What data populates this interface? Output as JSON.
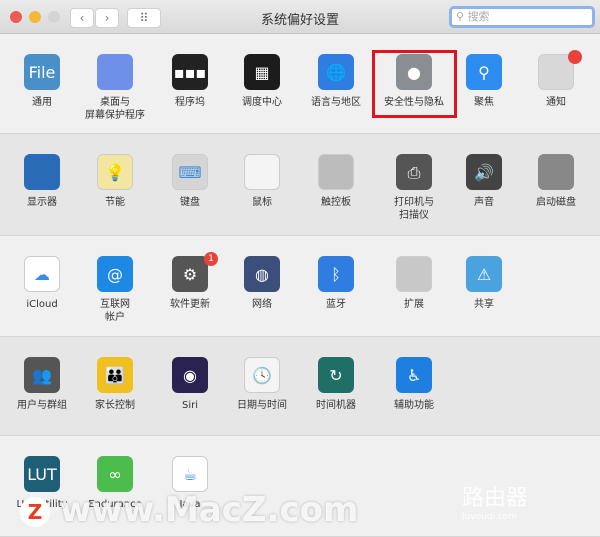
{
  "window": {
    "title": "系统偏好设置",
    "search_placeholder": "搜索",
    "back": "‹",
    "forward": "›",
    "grid": "⠿"
  },
  "rows": [
    {
      "items": [
        {
          "label": "通用",
          "icon": "general-icon",
          "color": "#4a90c8",
          "glyph": "File"
        },
        {
          "label": "桌面与\n屏幕保护程序",
          "icon": "desktop-screensaver-icon",
          "color": "#6f8fe8",
          "glyph": ""
        },
        {
          "label": "程序坞",
          "icon": "dock-icon",
          "color": "#222",
          "glyph": "▪▪▪"
        },
        {
          "label": "调度中心",
          "icon": "mission-control-icon",
          "color": "#1c1c1c",
          "glyph": "▦"
        },
        {
          "label": "语言与地区",
          "icon": "language-region-icon",
          "color": "#2f7de0",
          "glyph": "🌐"
        },
        {
          "label": "安全性与隐私",
          "icon": "security-privacy-icon",
          "color": "#8a8d92",
          "glyph": "●"
        },
        {
          "label": "聚焦",
          "icon": "spotlight-icon",
          "color": "#2d8cf0",
          "glyph": "⚲"
        },
        {
          "label": "通知",
          "icon": "notifications-icon",
          "color": "#d8d8d8",
          "glyph": ""
        }
      ]
    },
    {
      "items": [
        {
          "label": "显示器",
          "icon": "displays-icon",
          "color": "#2a6bb8",
          "glyph": ""
        },
        {
          "label": "节能",
          "icon": "energy-saver-icon",
          "color": "#f2e7a0",
          "glyph": "💡"
        },
        {
          "label": "键盘",
          "icon": "keyboard-icon",
          "color": "#d5d5d5",
          "glyph": "⌨"
        },
        {
          "label": "鼠标",
          "icon": "mouse-icon",
          "color": "#f4f4f4",
          "glyph": ""
        },
        {
          "label": "触控板",
          "icon": "trackpad-icon",
          "color": "#bcbcbc",
          "glyph": ""
        },
        {
          "label": "打印机与\n扫描仪",
          "icon": "printers-scanners-icon",
          "color": "#555",
          "glyph": "⎙"
        },
        {
          "label": "声音",
          "icon": "sound-icon",
          "color": "#444",
          "glyph": "🔊"
        },
        {
          "label": "启动磁盘",
          "icon": "startup-disk-icon",
          "color": "#888",
          "glyph": ""
        }
      ]
    },
    {
      "items": [
        {
          "label": "iCloud",
          "icon": "icloud-icon",
          "color": "#ffffff",
          "glyph": "☁"
        },
        {
          "label": "互联网\n帐户",
          "icon": "internet-accounts-icon",
          "color": "#1e88e5",
          "glyph": "@"
        },
        {
          "label": "软件更新",
          "icon": "software-update-icon",
          "color": "#555",
          "glyph": "⚙",
          "badge": "1"
        },
        {
          "label": "网络",
          "icon": "network-icon",
          "color": "#3b4f7a",
          "glyph": "◍"
        },
        {
          "label": "蓝牙",
          "icon": "bluetooth-icon",
          "color": "#2f7de0",
          "glyph": "ᛒ"
        },
        {
          "label": "扩展",
          "icon": "extensions-icon",
          "color": "#c8c8c8",
          "glyph": ""
        },
        {
          "label": "共享",
          "icon": "sharing-icon",
          "color": "#4aa3df",
          "glyph": "⚠"
        }
      ]
    },
    {
      "items": [
        {
          "label": "用户与群组",
          "icon": "users-groups-icon",
          "color": "#555",
          "glyph": "👥"
        },
        {
          "label": "家长控制",
          "icon": "parental-controls-icon",
          "color": "#f0c020",
          "glyph": "👪"
        },
        {
          "label": "Siri",
          "icon": "siri-icon",
          "color": "#2a2250",
          "glyph": "◉"
        },
        {
          "label": "日期与时间",
          "icon": "date-time-icon",
          "color": "#f4f4f4",
          "glyph": "🕓"
        },
        {
          "label": "时间机器",
          "icon": "time-machine-icon",
          "color": "#1f6f66",
          "glyph": "↻"
        },
        {
          "label": "辅助功能",
          "icon": "accessibility-icon",
          "color": "#1e7fe0",
          "glyph": "♿"
        }
      ]
    },
    {
      "items": [
        {
          "label": "LUT Utility",
          "icon": "lut-utility-icon",
          "color": "#1e5f77",
          "glyph": "LUT"
        },
        {
          "label": "Endurance",
          "icon": "endurance-icon",
          "color": "#4cbd4c",
          "glyph": "∞"
        },
        {
          "label": "Java",
          "icon": "java-icon",
          "color": "#ffffff",
          "glyph": "☕"
        }
      ]
    }
  ],
  "watermarks": {
    "macz": "www.MacZ.com",
    "macz_logo": "Z",
    "luyouqi": "路由器",
    "luyouqi_url": "luyouqi.com"
  }
}
